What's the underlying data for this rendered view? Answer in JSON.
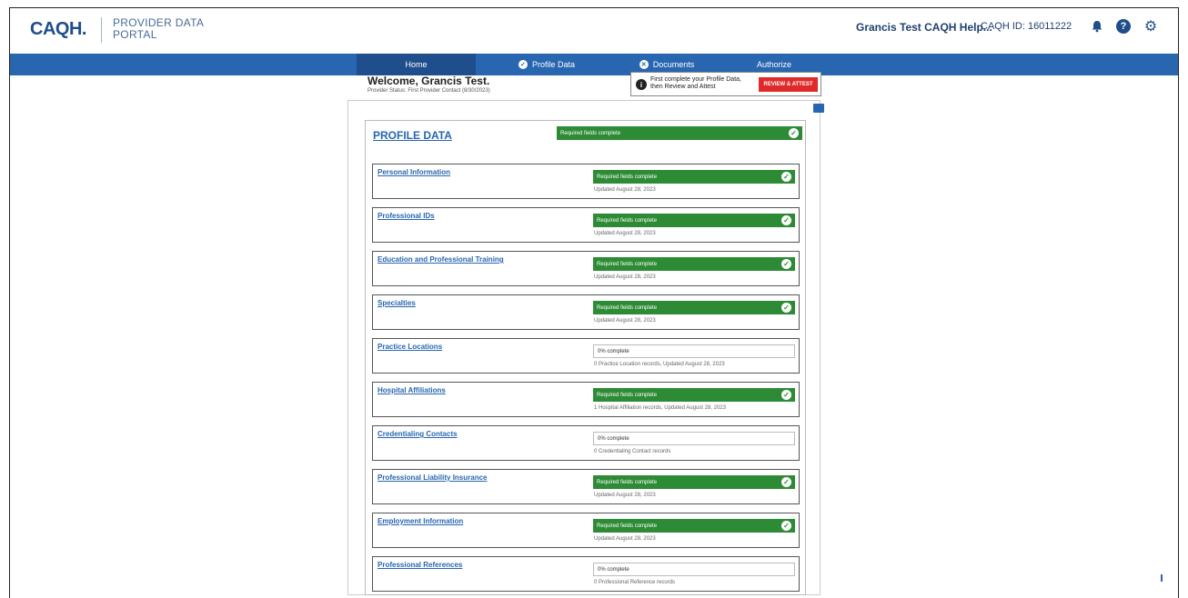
{
  "header": {
    "logo": "CAQH.",
    "portal_line1": "PROVIDER DATA",
    "portal_line2": "PORTAL",
    "user_name": "Grancis Test CAQH Help...",
    "caqh_id": "CAQH ID: 16011222"
  },
  "nav": {
    "home": "Home",
    "profile_data": "Profile Data",
    "documents": "Documents",
    "authorize": "Authorize"
  },
  "welcome": {
    "title": "Welcome, Grancis Test.",
    "status": "Provider Status: First Provider Contact (8/30/2023)"
  },
  "attest": {
    "message": "First complete your Profile Data, then Review and Attest",
    "button": "REVIEW & ATTEST"
  },
  "profile": {
    "title": "PROFILE DATA",
    "status": "Required fields complete",
    "sections": [
      {
        "title": "Personal Information",
        "status": "Required fields complete",
        "complete": true,
        "sub": "Updated August 28, 2023"
      },
      {
        "title": "Professional IDs",
        "status": "Required fields complete",
        "complete": true,
        "sub": "Updated August 28, 2023"
      },
      {
        "title": "Education and Professional Training",
        "status": "Required fields complete",
        "complete": true,
        "sub": "Updated August 28, 2023"
      },
      {
        "title": "Specialties",
        "status": "Required fields complete",
        "complete": true,
        "sub": "Updated August 28, 2023"
      },
      {
        "title": "Practice Locations",
        "status": "0% complete",
        "complete": false,
        "sub": "0 Practice Location records, Updated August 28, 2023"
      },
      {
        "title": "Hospital Affiliations",
        "status": "Required fields complete",
        "complete": true,
        "sub": "1 Hospital Affiliation records, Updated August 28, 2023"
      },
      {
        "title": "Credentialing Contacts",
        "status": "0% complete",
        "complete": false,
        "sub": "0 Credentialing Contact records"
      },
      {
        "title": "Professional Liability Insurance",
        "status": "Required fields complete",
        "complete": true,
        "sub": "Updated August 28, 2023"
      },
      {
        "title": "Employment Information",
        "status": "Required fields complete",
        "complete": true,
        "sub": "Updated August 28, 2023"
      },
      {
        "title": "Professional References",
        "status": "0% complete",
        "complete": false,
        "sub": "0 Professional Reference records"
      }
    ]
  }
}
